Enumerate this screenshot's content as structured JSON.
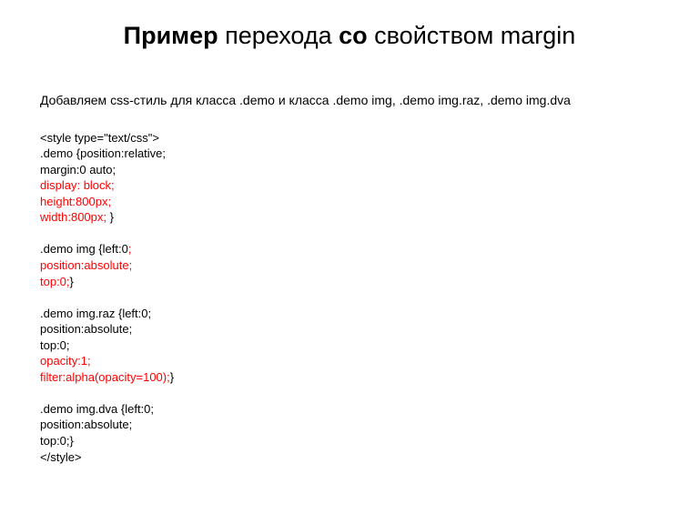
{
  "title": {
    "part1": "Пример",
    "part2": " перехода ",
    "part3": "со",
    "part4": " свойством ",
    "part5": "margin"
  },
  "intro": "Добавляем css-стиль для класса .demo и класса .demo img, .demo img.raz, .demo img.dva",
  "code": {
    "l1": "<style type=\"text/css\">",
    "l2": ".demo {position:relative;",
    "l3": "margin:0 auto;",
    "l4": "display: block;",
    "l5": "height:800px;",
    "l6": "width:800px;",
    "l6b": " }",
    "l7": "",
    "l8": ".demo img {left:0",
    "l8b": ";",
    "l9": "position:absolute;",
    "l10": "top:0;",
    "l10b": "}",
    "l11": "",
    "l12": ".demo img.raz {left:0;",
    "l13": "position:absolute;",
    "l14": "top:0;",
    "l15": "opacity:1;",
    "l16": "filter:alpha(opacity=100);",
    "l16b": "}",
    "l17": "",
    "l18": ".demo img.dva {left:0;",
    "l19": "position:absolute;",
    "l20": "top:0;}",
    "l21": "</style>"
  }
}
